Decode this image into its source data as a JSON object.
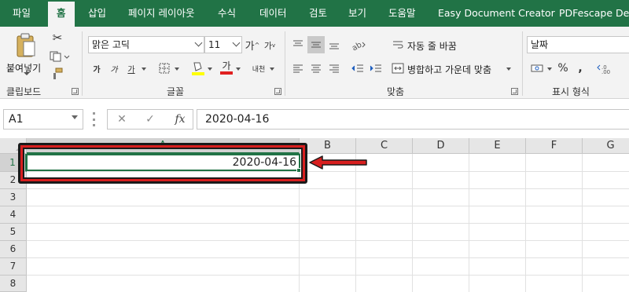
{
  "ribbon_tabs": [
    {
      "label": "파일"
    },
    {
      "label": "홈",
      "active": true
    },
    {
      "label": "삽입"
    },
    {
      "label": "페이지 레이아웃"
    },
    {
      "label": "수식"
    },
    {
      "label": "데이터"
    },
    {
      "label": "검토"
    },
    {
      "label": "보기"
    },
    {
      "label": "도움말"
    },
    {
      "label": "Easy Document Creator"
    },
    {
      "label": "PDFescape Desk"
    }
  ],
  "clipboard": {
    "paste_label": "붙여넣기",
    "group_label": "클립보드"
  },
  "font": {
    "font_name": "맑은 고딕",
    "font_size": "11",
    "grow_label": "가",
    "shrink_label": "가",
    "bold_label": "가",
    "italic_label": "가",
    "underline_label": "가",
    "font_color_label": "가",
    "phonetic_label": "내천",
    "group_label": "글꼴"
  },
  "alignment": {
    "wrap_text_label": "자동 줄 바꿈",
    "merge_center_label": "병합하고 가운데 맞춤",
    "group_label": "맞춤"
  },
  "number": {
    "format_value": "날짜",
    "percent_label": "%",
    "comma_label": ",",
    "group_label": "표시 형식"
  },
  "formula_bar": {
    "name_box": "A1",
    "fx_label": "fx",
    "formula_value": "2020-04-16"
  },
  "sheet": {
    "columns": [
      "A",
      "B",
      "C",
      "D",
      "E",
      "F",
      "G"
    ],
    "rows": [
      "1",
      "2",
      "3",
      "4",
      "5",
      "6",
      "7",
      "8"
    ],
    "selected_cell": "A1",
    "cell_a1_value": "2020-04-16"
  },
  "colors": {
    "accent": "#217346",
    "annotation": "#d81f1f"
  }
}
